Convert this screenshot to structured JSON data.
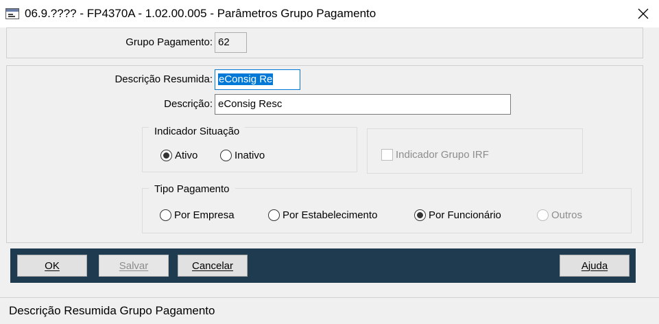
{
  "window": {
    "title": "06.9.???? - FP4370A - 1.02.00.005 - Parâmetros Grupo Pagamento"
  },
  "header": {
    "grupo_label": "Grupo Pagamento:",
    "grupo_value": "62"
  },
  "form": {
    "descricao_resumida_label": "Descrição Resumida:",
    "descricao_resumida_value": "eConsig Re",
    "descricao_label": "Descrição:",
    "descricao_value": "eConsig Resc"
  },
  "indicador_situacao": {
    "title": "Indicador Situação",
    "options": [
      {
        "label": "Ativo",
        "selected": true
      },
      {
        "label": "Inativo",
        "selected": false
      }
    ]
  },
  "indicador_grupo_irf": {
    "label": "Indicador Grupo IRF",
    "checked": false,
    "enabled": false
  },
  "tipo_pagamento": {
    "title": "Tipo Pagamento",
    "options": [
      {
        "label": "Por Empresa",
        "selected": false,
        "enabled": true
      },
      {
        "label": "Por Estabelecimento",
        "selected": false,
        "enabled": true
      },
      {
        "label": "Por Funcionário",
        "selected": true,
        "enabled": true
      },
      {
        "label": "Outros",
        "selected": false,
        "enabled": false
      }
    ]
  },
  "buttons": {
    "ok": "OK",
    "salvar": "Salvar",
    "cancelar": "Cancelar",
    "ajuda": "Ajuda"
  },
  "status_bar": {
    "text": "Descrição Resumida Grupo Pagamento"
  },
  "colors": {
    "button_bar": "#1e3b4f",
    "selection": "#0078d7"
  }
}
